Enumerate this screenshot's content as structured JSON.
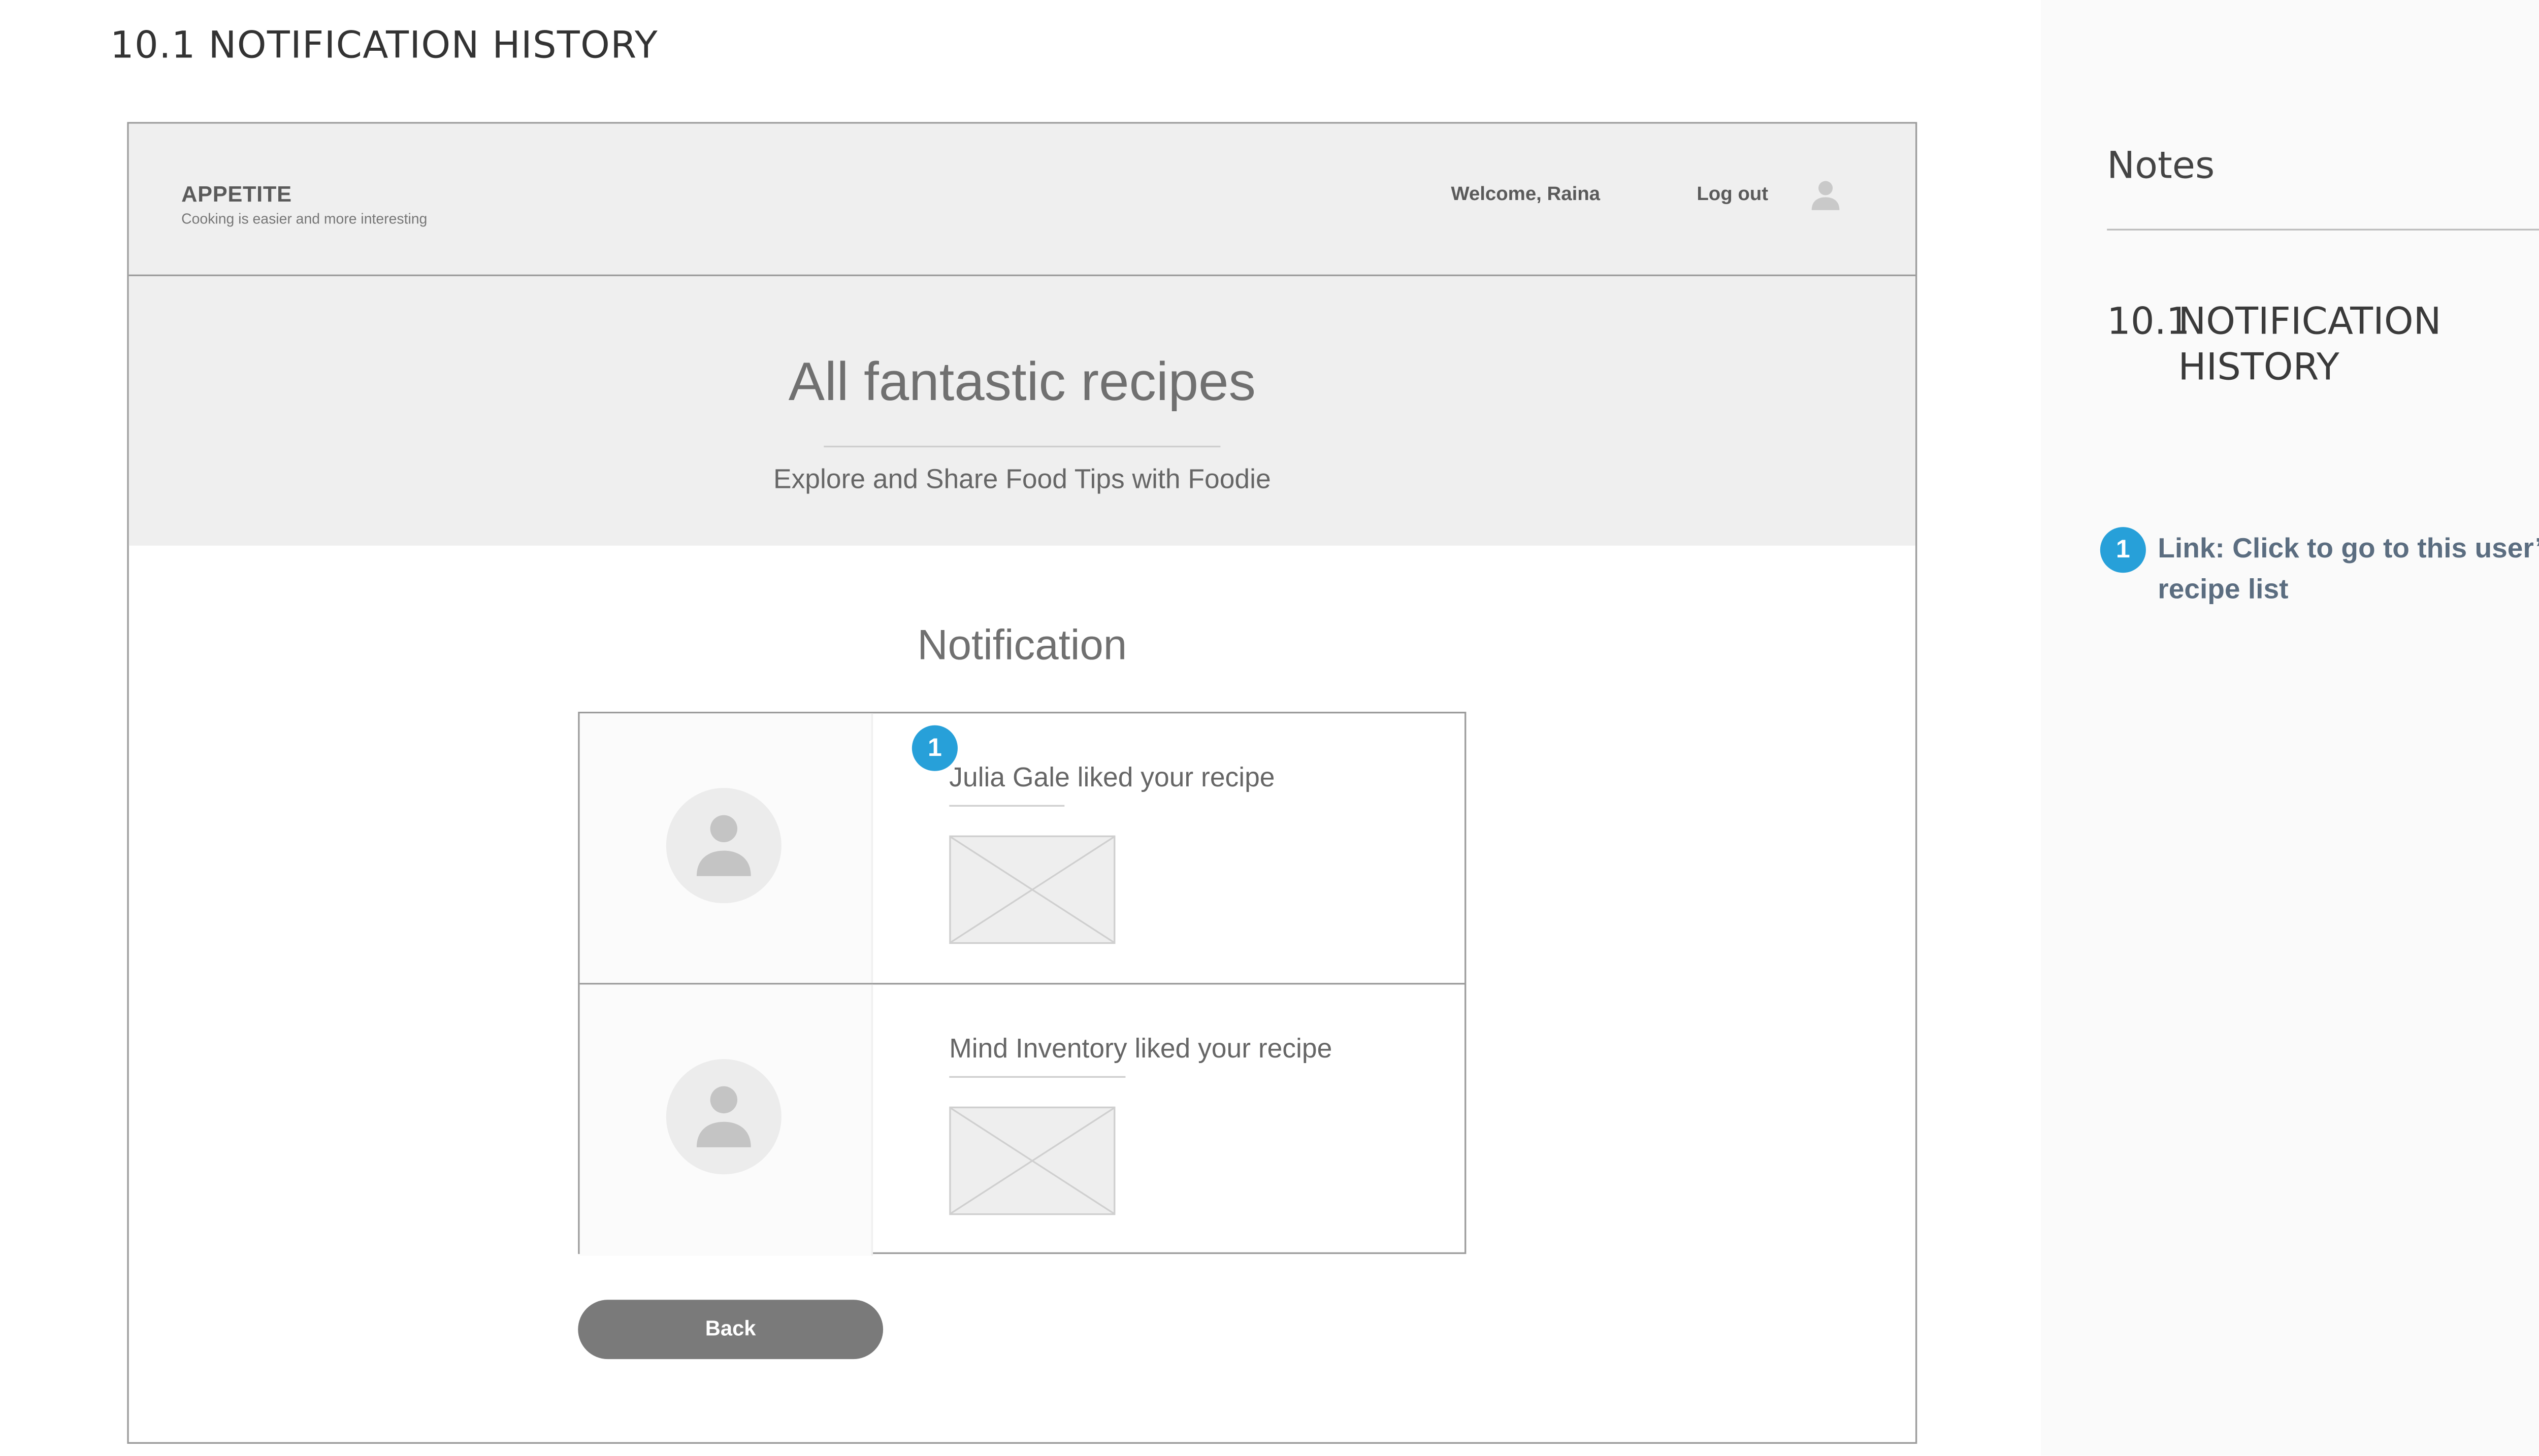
{
  "page": {
    "title": "10.1  NOTIFICATION HISTORY"
  },
  "app": {
    "brand": "APPETITE",
    "tagline": "Cooking is easier and more interesting",
    "welcome": "Welcome, Raina",
    "logout_label": "Log out"
  },
  "hero": {
    "title": "All fantastic recipes",
    "subtitle": "Explore and Share Food Tips with Foodie"
  },
  "notifications": {
    "heading": "Notification",
    "items": [
      {
        "text": "Julia Gale liked your recipe",
        "link_text": "Julia Gale"
      },
      {
        "text": "Mind Inventory liked your recipe",
        "link_text": "Mind Inventory"
      }
    ]
  },
  "back_label": "Back",
  "notes": {
    "title": "Notes",
    "section_number": "10.1",
    "section_line1": "NOTIFICATION",
    "section_line2": "HISTORY",
    "items": [
      {
        "marker": "1",
        "text": "Link: Click to go to this user’s recipe list"
      }
    ]
  },
  "colors": {
    "marker": "#27a0d9",
    "button": "#7a7a7a",
    "wire_bg": "#efefef",
    "note_text": "#5b6d80"
  },
  "icons": {
    "user": "user-icon",
    "image_placeholder": "image-placeholder-icon"
  }
}
